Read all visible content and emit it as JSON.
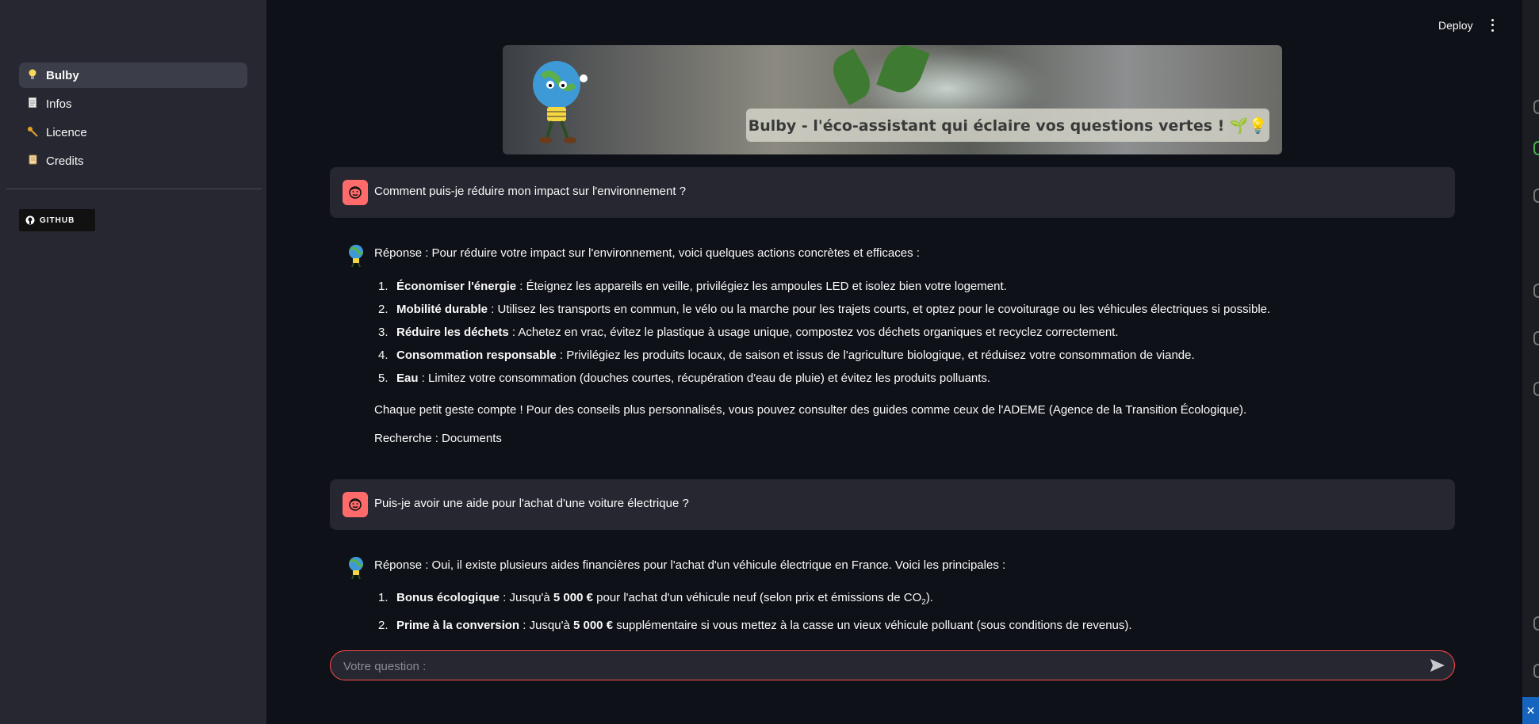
{
  "sidebar": {
    "items": [
      {
        "label": "Bulby",
        "icon": "lightbulb-icon"
      },
      {
        "label": "Infos",
        "icon": "page-icon"
      },
      {
        "label": "Licence",
        "icon": "key-icon"
      },
      {
        "label": "Credits",
        "icon": "scroll-icon"
      }
    ],
    "github_label": "GITHUB"
  },
  "header": {
    "deploy_label": "Deploy"
  },
  "banner": {
    "caption": "Bulby - l'éco-assistant qui éclaire vos questions vertes ! 🌱💡"
  },
  "chat": {
    "q1": "Comment puis-je réduire mon impact sur l'environnement ?",
    "a1": {
      "intro": "Réponse : Pour réduire votre impact sur l'environnement, voici quelques actions concrètes et efficaces :",
      "items": [
        {
          "n": "1.",
          "title": "Économiser l'énergie",
          "text": " : Éteignez les appareils en veille, privilégiez les ampoules LED et isolez bien votre logement."
        },
        {
          "n": "2.",
          "title": "Mobilité durable",
          "text": " : Utilisez les transports en commun, le vélo ou la marche pour les trajets courts, et optez pour le covoiturage ou les véhicules électriques si possible."
        },
        {
          "n": "3.",
          "title": "Réduire les déchets",
          "text": " : Achetez en vrac, évitez le plastique à usage unique, compostez vos déchets organiques et recyclez correctement."
        },
        {
          "n": "4.",
          "title": "Consommation responsable",
          "text": " : Privilégiez les produits locaux, de saison et issus de l'agriculture biologique, et réduisez votre consommation de viande."
        },
        {
          "n": "5.",
          "title": "Eau",
          "text": " : Limitez votre consommation (douches courtes, récupération d'eau de pluie) et évitez les produits polluants."
        }
      ],
      "outro": "Chaque petit geste compte ! Pour des conseils plus personnalisés, vous pouvez consulter des guides comme ceux de l'ADEME (Agence de la Transition Écologique).",
      "search": "Recherche : Documents"
    },
    "q2": "Puis-je avoir une aide pour l'achat d'une voiture électrique ?",
    "a2": {
      "intro": "Réponse : Oui, il existe plusieurs aides financières pour l'achat d'un véhicule électrique en France. Voici les principales :",
      "items": [
        {
          "n": "1.",
          "title": "Bonus écologique",
          "t1": " : Jusqu'à ",
          "amount": "5 000 €",
          "t2": " pour l'achat d'un véhicule neuf (selon prix et émissions de CO",
          "sub": "2",
          "t3": ")."
        },
        {
          "n": "2.",
          "title": "Prime à la conversion",
          "t1": " : Jusqu'à ",
          "amount": "5 000 €",
          "t2": " supplémentaire si vous mettez à la casse un vieux véhicule polluant (sous conditions de revenus).",
          "sub": "",
          "t3": ""
        }
      ]
    }
  },
  "input": {
    "placeholder": "Votre question :",
    "value": ""
  },
  "colors": {
    "accent": "#ff4b4b",
    "user_avatar": "#ff6b6b",
    "sidebar_bg": "#262730",
    "app_bg": "#0e1117"
  }
}
